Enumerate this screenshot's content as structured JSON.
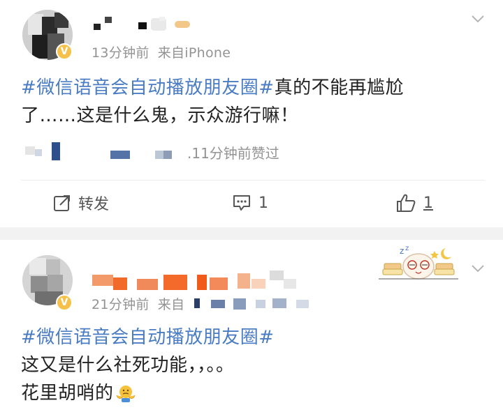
{
  "post1": {
    "time": "13分钟前",
    "source": "来自iPhone",
    "hashtag": "#微信语音会自动播放朋友圈#",
    "text_line1_rest": "真的不能再尴尬",
    "text_line2": "了……这是什么鬼，示众游行嘛！",
    "liked_text": ".11分钟前赞过",
    "actions": {
      "repost_label": "转发",
      "comment_count": "1",
      "like_count": "1"
    }
  },
  "post2": {
    "time": "21分钟前",
    "source_partial": "来自",
    "hashtag": "#微信语音会自动播放朋友圈#",
    "text_line2": "这又是什么社死功能，，。。",
    "text_line3": "花里胡哨的"
  },
  "colors": {
    "hashtag": "#4a7cc3",
    "meta_gray": "#939393",
    "badge_gold": "#f6c14b",
    "band_gray": "#f2f2f2"
  },
  "icons": [
    "chevron-down-icon",
    "verified-badge-icon",
    "repost-icon",
    "comment-icon",
    "like-icon",
    "shrug-emoji-icon",
    "sleepy-sticker-icon"
  ]
}
